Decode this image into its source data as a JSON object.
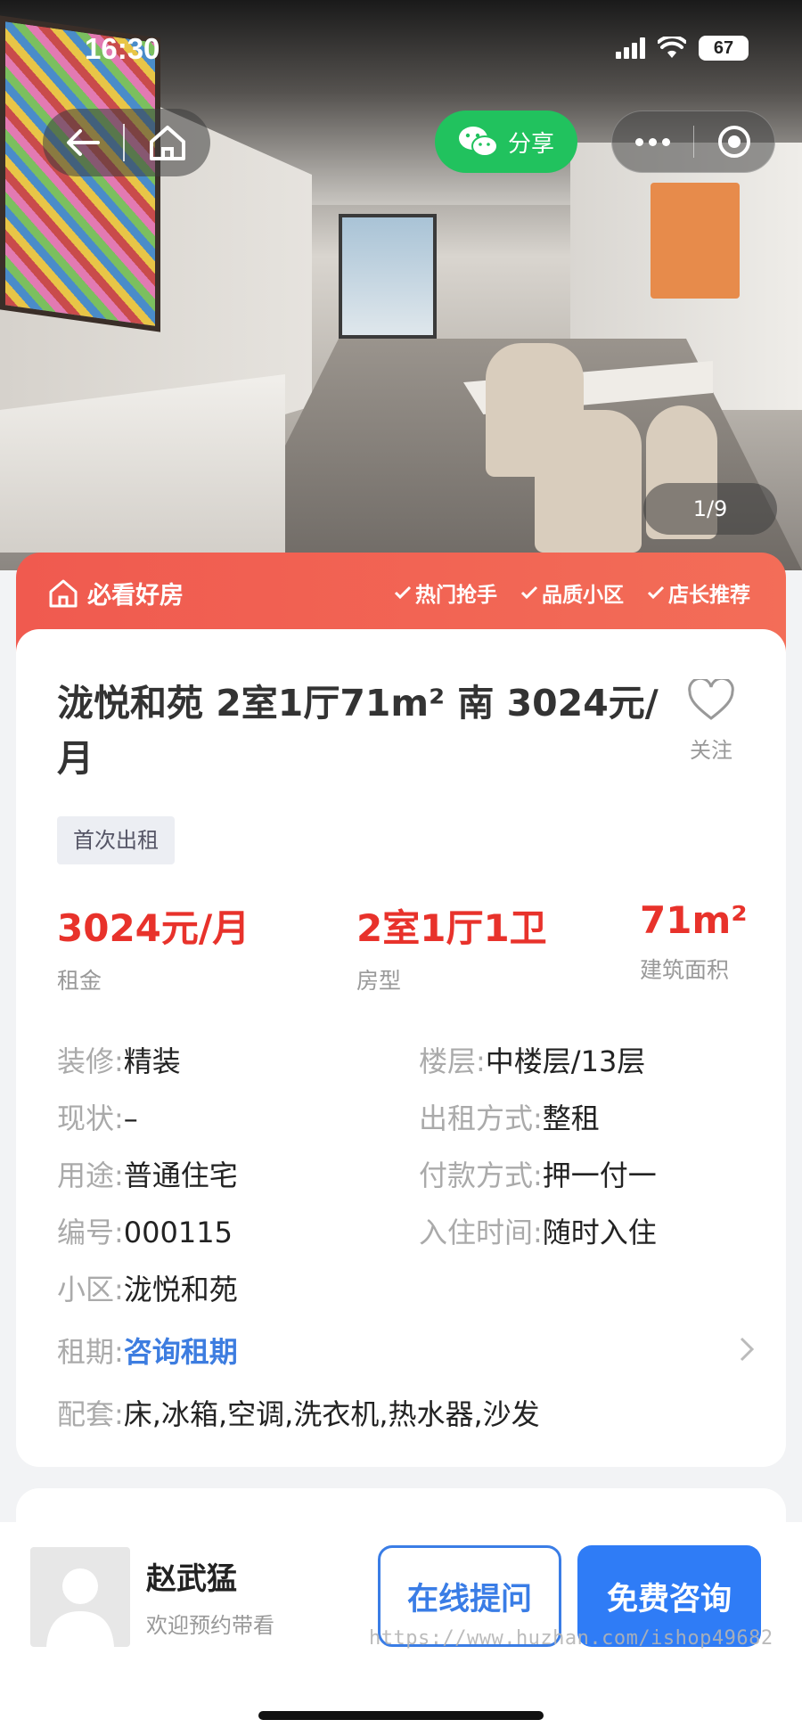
{
  "status_bar": {
    "time": "16:30",
    "battery": "67"
  },
  "nav": {
    "share_label": "分享"
  },
  "gallery": {
    "counter": "1/9"
  },
  "banner": {
    "title": "必看好房",
    "tags": [
      "热门抢手",
      "品质小区",
      "店长推荐"
    ]
  },
  "listing": {
    "title": "泷悦和苑 2室1厅71m² 南 3024元/月",
    "follow_label": "关注",
    "first_tag": "首次出租",
    "kpis": [
      {
        "value": "3024元/月",
        "label": "租金"
      },
      {
        "value": "2室1厅1卫",
        "label": "房型"
      },
      {
        "value": "71m²",
        "label": "建筑面积"
      }
    ],
    "attrs": {
      "decoration": {
        "key": "装修:",
        "value": "精装"
      },
      "floor": {
        "key": "楼层:",
        "value": "中楼层/13层"
      },
      "status": {
        "key": "现状:",
        "value": "–"
      },
      "rent_type": {
        "key": "出租方式:",
        "value": "整租"
      },
      "usage": {
        "key": "用途:",
        "value": "普通住宅"
      },
      "payment": {
        "key": "付款方式:",
        "value": "押一付一"
      },
      "code": {
        "key": "编号:",
        "value": "000115"
      },
      "movein": {
        "key": "入住时间:",
        "value": "随时入住"
      },
      "community": {
        "key": "小区:",
        "value": "泷悦和苑"
      },
      "lease": {
        "key": "租期:",
        "value": "咨询租期"
      },
      "facilities": {
        "key": "配套:",
        "value": "床,冰箱,空调,洗衣机,热水器,沙发"
      }
    }
  },
  "agent": {
    "name": "赵武猛",
    "subtitle": "欢迎预约带看",
    "ask_label": "在线提问",
    "consult_label": "免费咨询"
  },
  "watermark": "https://www.huzhan.com/ishop49682",
  "colors": {
    "accent_red": "#e8322b",
    "banner_red": "#f05a4f",
    "primary_blue": "#2f7cf6",
    "share_green": "#21c25e"
  }
}
